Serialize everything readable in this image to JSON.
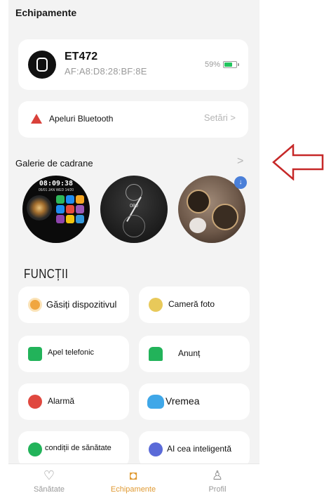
{
  "header": {
    "title": "Echipamente"
  },
  "device": {
    "name": "ET472",
    "mac": "AF:A8:D8:28:BF:8E",
    "battery_label": "59%",
    "battery_level": 0.59,
    "icon": "watch-icon"
  },
  "bluetooth_calls": {
    "label": "Apeluri Bluetooth",
    "settings_label": "Setări >",
    "icon": "warning-triangle-icon"
  },
  "gallery": {
    "title": "Galerie de cadrane",
    "chevron": ">",
    "watch1": {
      "time": "08:09:38",
      "meta": "05/01  JAN  WED  14/20"
    },
    "watch2": {
      "number": "080"
    },
    "download_badge": "↓"
  },
  "functions": {
    "title": "FUNCȚII",
    "items": [
      {
        "label": "Găsiți dispozitivul",
        "icon": "locate-device-icon",
        "color": "#f0a640"
      },
      {
        "label": "Cameră foto",
        "icon": "camera-icon",
        "color": "#e8c95a"
      },
      {
        "label": "Apel telefonic",
        "icon": "phone-icon",
        "color": "#22b35a"
      },
      {
        "label": "Anunț",
        "icon": "notification-icon",
        "color": "#22b35a"
      },
      {
        "label": "Alarmă",
        "icon": "alarm-icon",
        "color": "#e0483f"
      },
      {
        "label": "Vremea",
        "icon": "weather-icon",
        "color": "#3fa7e8"
      },
      {
        "label": "condiții de sănătate",
        "icon": "health-person-icon",
        "color": "#22b35a"
      },
      {
        "label": "AI cea inteligentă",
        "icon": "ai-robot-icon",
        "color": "#5a6ad8"
      }
    ]
  },
  "nav": {
    "items": [
      {
        "label": "Sănătate",
        "icon": "heart-plus-icon",
        "active": false
      },
      {
        "label": "Echipamente",
        "icon": "watch-icon",
        "active": true
      },
      {
        "label": "Profil",
        "icon": "person-icon",
        "active": false
      }
    ]
  },
  "colors": {
    "accent": "#e09a33",
    "arrow": "#c62828",
    "battery_fill": "#22c55e"
  }
}
